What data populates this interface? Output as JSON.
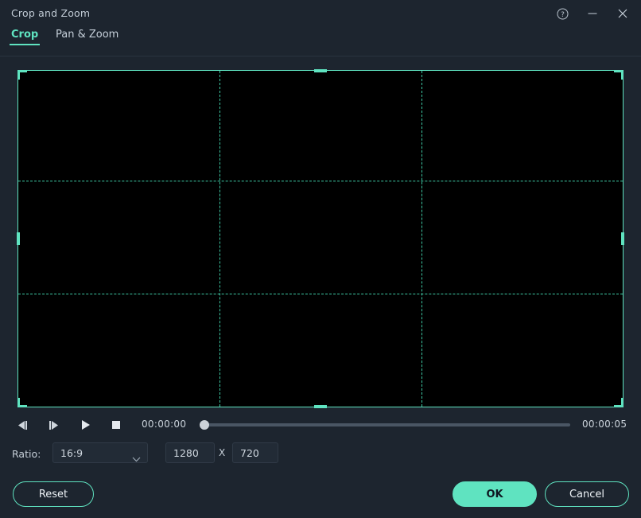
{
  "window": {
    "title": "Crop and Zoom",
    "controls": [
      {
        "name": "help-icon",
        "label": "?"
      },
      {
        "name": "minimize-icon",
        "label": "–"
      },
      {
        "name": "close-icon",
        "label": "×"
      }
    ]
  },
  "tabs": {
    "active": "Crop",
    "items": [
      {
        "label": "Crop",
        "active": true
      },
      {
        "label": "Pan & Zoom",
        "active": false
      }
    ]
  },
  "preview": {
    "crop_frame": {
      "border_color": "#5fe3c0",
      "grid": "rule-of-thirds",
      "grid_color": "#3ec9a4",
      "canvas_color": "#000000",
      "handles": [
        "top-left",
        "top-center",
        "top-right",
        "middle-left",
        "middle-right",
        "bottom-left",
        "bottom-center",
        "bottom-right"
      ]
    }
  },
  "transport": {
    "prev_frame_label": "Previous frame",
    "next_frame_label": "Next frame",
    "play_label": "Play",
    "stop_label": "Stop",
    "current_time": "00:00:00",
    "total_time": "00:00:05",
    "progress_percent": 0
  },
  "ratio_bar": {
    "label": "Ratio:",
    "selected_ratio": "16:9",
    "options": [
      "16:9"
    ],
    "width_value": "1280",
    "separator": "X",
    "height_value": "720"
  },
  "footer": {
    "reset_label": "Reset",
    "ok_label": "OK",
    "cancel_label": "Cancel"
  },
  "colors": {
    "accent": "#5fe3c0",
    "background": "#1d252f",
    "canvas": "#000000",
    "text": "#c9d2dc"
  }
}
